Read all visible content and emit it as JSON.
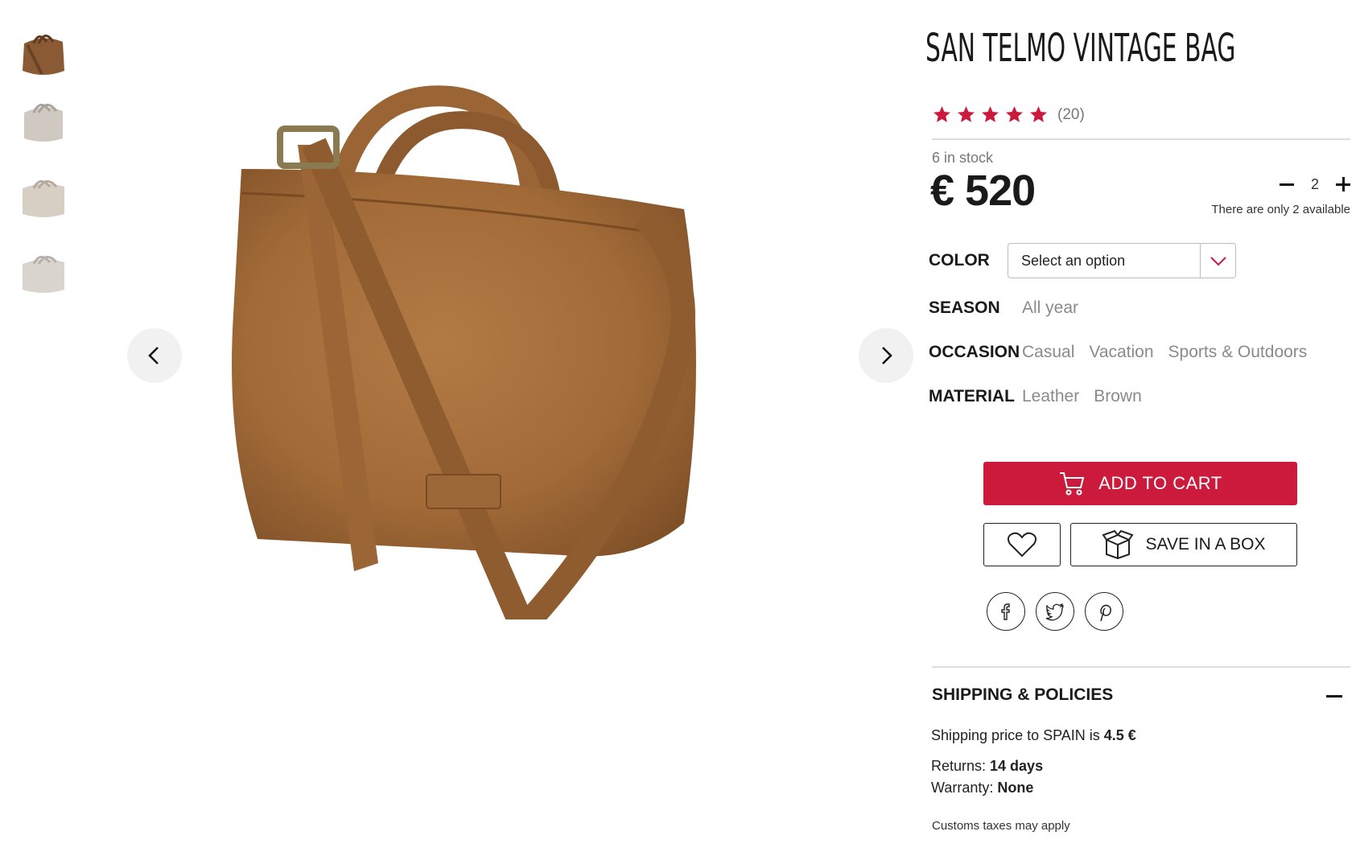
{
  "gallery": {
    "thumbnails": [
      {
        "label": "Brown bag thumbnail",
        "color": "#8a5a34"
      },
      {
        "label": "Grey bag thumbnail",
        "color": "#cfc9c2"
      },
      {
        "label": "Beige bag thumbnail",
        "color": "#d8cfc4"
      },
      {
        "label": "Light bag thumbnail",
        "color": "#d9d4cd"
      }
    ],
    "main_image_color": "#a8703d",
    "prev_icon": "chevron-left-icon",
    "next_icon": "chevron-right-icon"
  },
  "product": {
    "title": "SAN TELMO VINTAGE BAG",
    "rating_stars": 5,
    "rating_count": "(20)",
    "stock": "6 in stock",
    "price": "€ 520",
    "quantity": "2",
    "quantity_note": "There are only 2 available"
  },
  "attributes": {
    "color_label": "COLOR",
    "color_select": "Select an option",
    "season_label": "SEASON",
    "season_values": [
      "All year"
    ],
    "occasion_label": "OCCASION",
    "occasion_values": [
      "Casual",
      "Vacation",
      "Sports & Outdoors"
    ],
    "material_label": "MATERIAL",
    "material_values": [
      "Leather",
      "Brown"
    ]
  },
  "actions": {
    "add_to_cart": "ADD TO CART",
    "save_in_box": "SAVE IN A BOX",
    "social": [
      "facebook-icon",
      "twitter-icon",
      "pinterest-icon"
    ]
  },
  "shipping": {
    "heading": "SHIPPING & POLICIES",
    "price_prefix": "Shipping price to SPAIN is ",
    "price_value": "4.5 €",
    "returns_label": "Returns: ",
    "returns_value": "14 days",
    "warranty_label": "Warranty: ",
    "warranty_value": "None",
    "customs": "Customs taxes may apply"
  },
  "colors": {
    "accent": "#cc1a3c",
    "text": "#1a1a1a",
    "muted": "#8a8a8a"
  }
}
